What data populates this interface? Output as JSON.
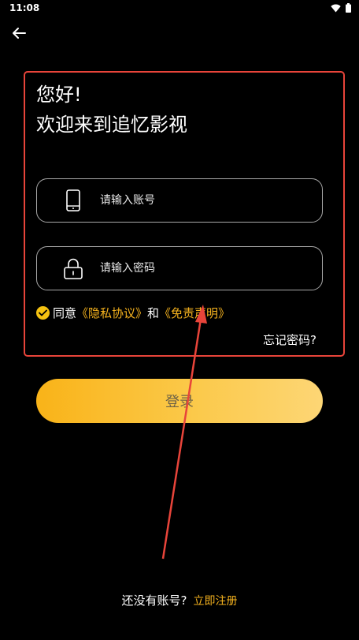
{
  "status_bar": {
    "time": "11:08",
    "icons": [
      "wifi-icon",
      "battery-icon"
    ]
  },
  "header": {
    "back_icon": "arrow-left-icon"
  },
  "greeting": {
    "line1": "您好!",
    "line2": "欢迎来到追忆影视"
  },
  "form": {
    "account_placeholder": "请输入账号",
    "account_icon": "phone-icon",
    "password_placeholder": "请输入密码",
    "password_icon": "lock-icon",
    "agree_prefix": "同意",
    "privacy_link": "《隐私协议》",
    "agree_and": "和",
    "disclaimer_link": "《免责声明》",
    "forgot_password": "忘记密码?",
    "login_button": "登录"
  },
  "footer": {
    "no_account": "还没有账号?",
    "register_link": "立即注册"
  },
  "colors": {
    "background": "#000000",
    "accent": "#f5b21e",
    "highlight": "#e8443a",
    "field_border": "#a8a8a8"
  }
}
